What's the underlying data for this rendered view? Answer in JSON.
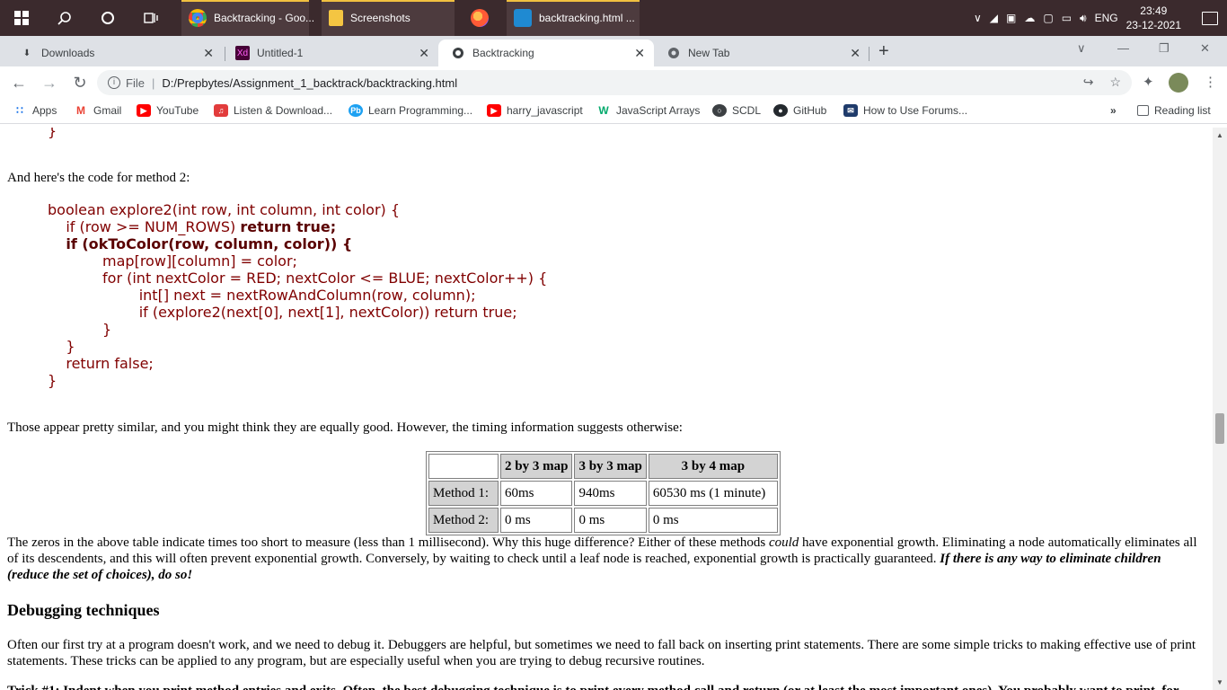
{
  "taskbar": {
    "apps": [
      {
        "label": "Backtracking - Goo..."
      },
      {
        "label": "Screenshots"
      },
      {
        "label": "backtracking.html ..."
      }
    ],
    "lang": "ENG",
    "time": "23:49",
    "date": "23-12-2021"
  },
  "tabs": [
    {
      "label": "Downloads"
    },
    {
      "label": "Untitled-1"
    },
    {
      "label": "Backtracking"
    },
    {
      "label": "New Tab"
    }
  ],
  "address": {
    "scheme_label": "File",
    "url": "D:/Prepbytes/Assignment_1_backtrack/backtracking.html"
  },
  "bookmarks": {
    "items": [
      {
        "label": "Apps"
      },
      {
        "label": "Gmail"
      },
      {
        "label": "YouTube"
      },
      {
        "label": "Listen & Download..."
      },
      {
        "label": "Learn Programming..."
      },
      {
        "label": "harry_javascript"
      },
      {
        "label": "JavaScript Arrays"
      },
      {
        "label": "SCDL"
      },
      {
        "label": "GitHub"
      },
      {
        "label": "How to Use Forums..."
      }
    ],
    "overflow": "»",
    "reading_list": "Reading list"
  },
  "article": {
    "top_brace": "}",
    "intro_method2": "And here's the code for method 2:",
    "code_lines": [
      "boolean explore2(int row, int column, int color) {",
      "    if (row >= NUM_ROWS) ",
      "return true;",
      "if (okToColor(row, column, color)) {",
      "    map[row][column] = color;",
      "    for (int nextColor = RED; nextColor <= BLUE; nextColor++) {",
      "        int[] next = nextRowAndColumn(row, column);",
      "        if (explore2(next[0], next[1], nextColor)) return true;",
      "    }",
      "}",
      "return false;",
      "}"
    ],
    "timing_intro": "Those appear pretty similar, and you might think they are equally good. However, the timing information suggests otherwise:",
    "table": {
      "headers": [
        "",
        "2 by 3 map",
        "3 by 3 map",
        "3 by 4 map"
      ],
      "rows": [
        [
          "Method 1:",
          "60ms",
          "940ms",
          "60530 ms (1 minute)"
        ],
        [
          "Method 2:",
          "0 ms",
          "0 ms",
          "0 ms"
        ]
      ]
    },
    "zeros_part1": "The zeros in the above table indicate times too short to measure (less than 1 millisecond). Why this huge difference? Either of these methods ",
    "zeros_italic": "could",
    "zeros_part2": " have exponential growth. Eliminating a node automatically eliminates all of its descendents, and this will often prevent exponential growth. Conversely, by waiting to check until a leaf node is reached, exponential growth is practically guaranteed. ",
    "zeros_bold_italic": "If there is any way to eliminate children (reduce the set of choices), do so!",
    "debug_heading": "Debugging techniques",
    "debug_para": "Often our first try at a program doesn't work, and we need to debug it. Debuggers are helpful, but sometimes we need to fall back on inserting print statements. There are some simple tricks to making effective use of print statements. These tricks can be applied to any program, but are especially useful when you are trying to debug recursive routines.",
    "trick_partial": "Trick #1: Indent when you print method entries and exits. Often, the best debugging technique is to print every method call and return (or at least the most important ones). You probably want to print, for"
  }
}
